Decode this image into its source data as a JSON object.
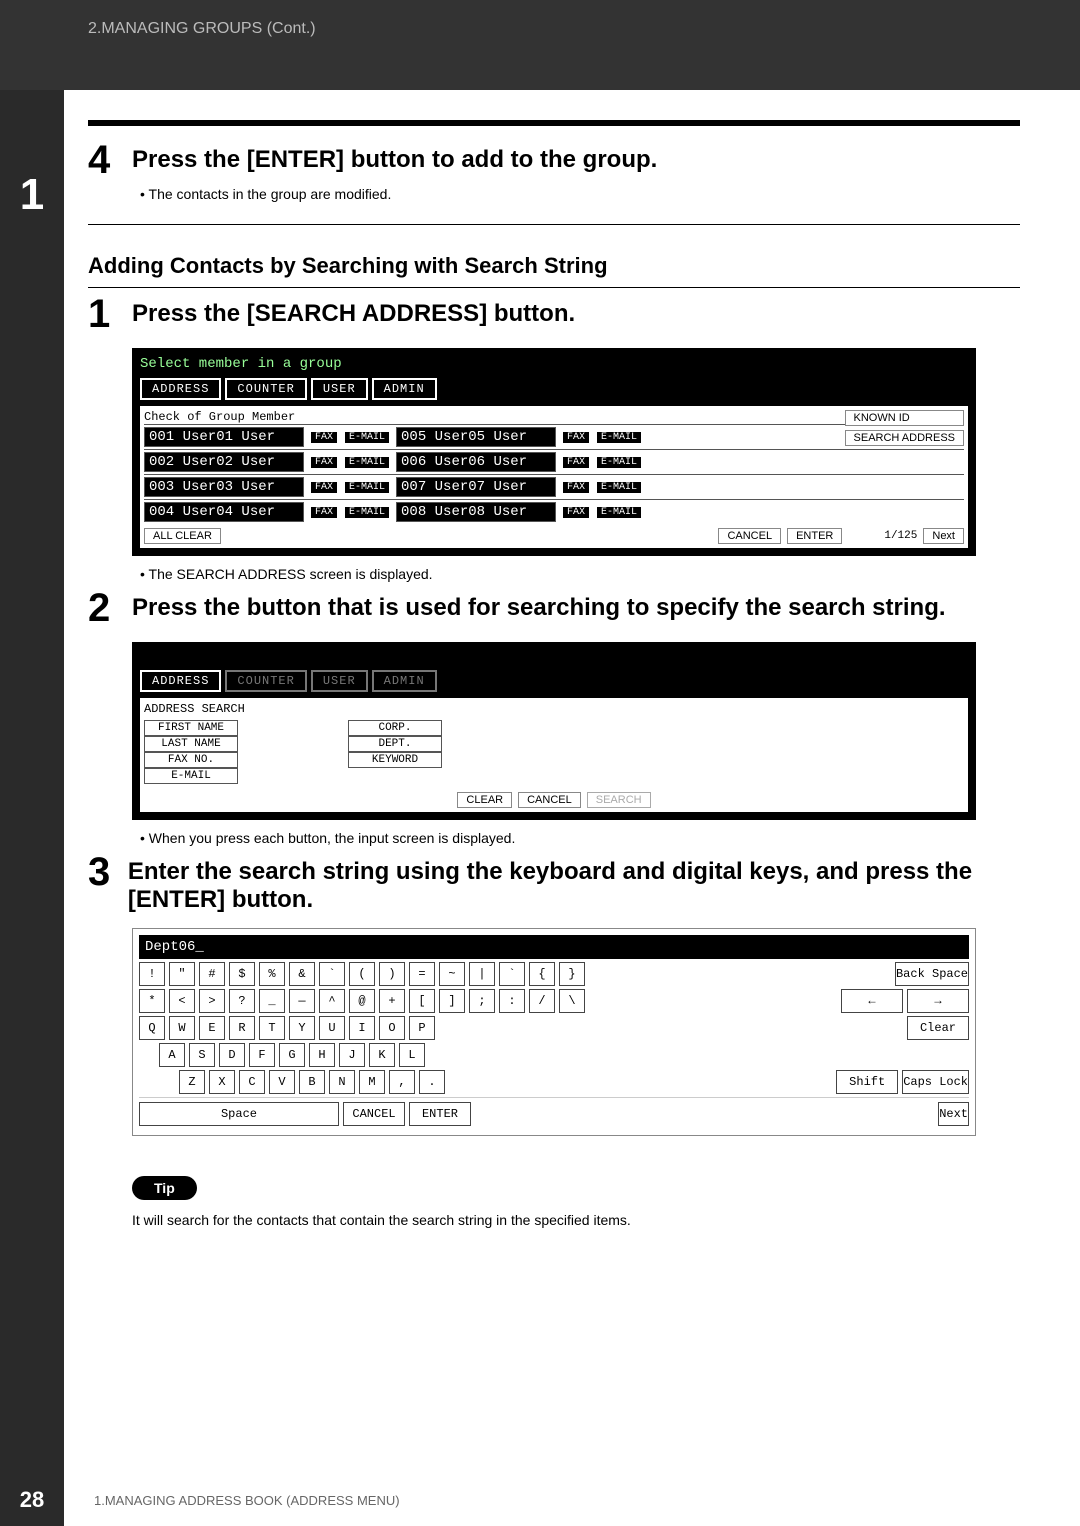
{
  "topbar_text": "2.MANAGING GROUPS (Cont.)",
  "chapter_num": "1",
  "step4": {
    "num": "4",
    "title": "Press the [ENTER] button to add to the group.",
    "bullet": "The contacts in the group are modified."
  },
  "subhead": "Adding Contacts by Searching with Search String",
  "step1": {
    "num": "1",
    "title": "Press the [SEARCH ADDRESS] button.",
    "bullet_after": "The SEARCH ADDRESS screen is displayed."
  },
  "screen1": {
    "headline": "Select member in a group",
    "tabs": {
      "address": "ADDRESS",
      "counter": "COUNTER",
      "user": "USER",
      "admin": "ADMIN"
    },
    "subline": "Check of Group Member",
    "rows": [
      {
        "left": "001 User01 User",
        "right": "005 User05 User"
      },
      {
        "left": "002 User02 User",
        "right": "006 User06 User"
      },
      {
        "left": "003 User03 User",
        "right": "007 User07 User"
      },
      {
        "left": "004 User04 User",
        "right": "008 User08 User"
      }
    ],
    "pill_fax": "FAX",
    "pill_mail": "E-MAIL",
    "rbtns": {
      "known_id": "KNOWN ID",
      "search_addr": "SEARCH ADDRESS"
    },
    "btm": {
      "allclear": "ALL CLEAR",
      "cancel": "CANCEL",
      "enter": "ENTER",
      "page": "1/125",
      "next": "Next"
    }
  },
  "step2": {
    "num": "2",
    "title": "Press the button that is used for searching to specify the search string.",
    "bullet_after": "When you press each button, the input screen is displayed."
  },
  "screen2": {
    "tabs": {
      "address": "ADDRESS",
      "counter": "COUNTER",
      "user": "USER",
      "admin": "ADMIN"
    },
    "subline": "ADDRESS SEARCH",
    "left_labels": [
      "FIRST NAME",
      "LAST NAME",
      "FAX NO.",
      "E-MAIL"
    ],
    "right_labels": [
      "CORP.",
      "DEPT.",
      "KEYWORD"
    ],
    "btm": {
      "clear": "CLEAR",
      "cancel": "CANCEL",
      "search": "SEARCH"
    }
  },
  "step3": {
    "num": "3",
    "title": "Enter the search string using the keyboard and digital keys, and press the [ENTER] button."
  },
  "keyboard": {
    "title": "Dept06_",
    "row1": [
      "!",
      "\"",
      "#",
      "$",
      "%",
      "&",
      "`",
      "(",
      ")",
      "=",
      "~",
      "|",
      "`",
      "{",
      "}"
    ],
    "row1_right": "Back Space",
    "row2": [
      "*",
      "<",
      ">",
      "?",
      "_",
      "—",
      "^",
      "@",
      "+",
      "[",
      "]",
      ";",
      ":",
      "/",
      "\\"
    ],
    "row2_right": [
      "←",
      "→"
    ],
    "row3": [
      "Q",
      "W",
      "E",
      "R",
      "T",
      "Y",
      "U",
      "I",
      "O",
      "P"
    ],
    "row3_right": "Clear",
    "row4": [
      "A",
      "S",
      "D",
      "F",
      "G",
      "H",
      "J",
      "K",
      "L"
    ],
    "row5": [
      "Z",
      "X",
      "C",
      "V",
      "B",
      "N",
      "M",
      ",",
      "."
    ],
    "row5_right": [
      "Shift",
      "Caps Lock"
    ],
    "btm": {
      "space": "Space",
      "cancel": "CANCEL",
      "enter": "ENTER",
      "next": "Next"
    }
  },
  "tip_label": "Tip",
  "tip_text": "It will search for the contacts that contain the search string in the specified items.",
  "footer": {
    "page": "28",
    "caption": "1.MANAGING ADDRESS BOOK (ADDRESS MENU)"
  }
}
